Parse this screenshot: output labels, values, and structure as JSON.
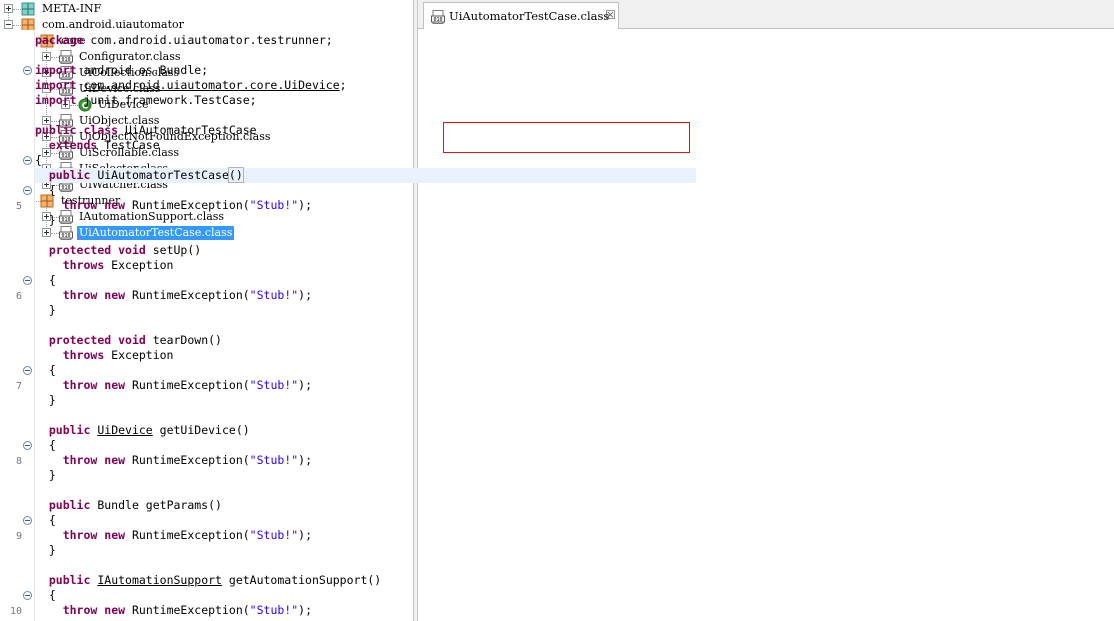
{
  "tree": {
    "nodes": [
      {
        "label": "META-INF",
        "icon": "folder-icon",
        "toggle": "plus"
      },
      {
        "label": "com.android.uiautomator",
        "icon": "package-icon",
        "toggle": "minus"
      },
      {
        "label": "core",
        "icon": "package-icon",
        "toggle": "minus"
      },
      {
        "label": "Configurator.class",
        "icon": "class-file-icon",
        "toggle": "plus"
      },
      {
        "label": "UiCollection.class",
        "icon": "class-file-icon",
        "toggle": "plus"
      },
      {
        "label": "UiDevice.class",
        "icon": "class-file-icon",
        "toggle": "minus"
      },
      {
        "label": "UiDevice",
        "icon": "class-icon",
        "toggle": "plus"
      },
      {
        "label": "UiObject.class",
        "icon": "class-file-icon",
        "toggle": "plus"
      },
      {
        "label": "UiObjectNotFoundException.class",
        "icon": "class-file-icon",
        "toggle": "plus"
      },
      {
        "label": "UiScrollable.class",
        "icon": "class-file-icon",
        "toggle": "plus"
      },
      {
        "label": "UiSelector.class",
        "icon": "class-file-icon",
        "toggle": "plus"
      },
      {
        "label": "UiWatcher.class",
        "icon": "class-file-icon",
        "toggle": "plus"
      },
      {
        "label": "testrunner",
        "icon": "package-icon",
        "toggle": "minus"
      },
      {
        "label": "IAutomationSupport.class",
        "icon": "class-file-icon",
        "toggle": "plus"
      },
      {
        "label": "UiAutomatorTestCase.class",
        "icon": "class-file-icon",
        "toggle": "plus",
        "selected": true
      }
    ]
  },
  "editor": {
    "tab_label": "UiAutomatorTestCase.class",
    "tab_close": "☒",
    "line_numbers": [
      "5",
      "6",
      "7",
      "8",
      "9",
      "10"
    ],
    "code_lines": [
      [
        {
          "t": "package",
          "k": "kw"
        },
        {
          "t": " com.android.uiautomator.testrunner;"
        }
      ],
      [],
      [
        {
          "t": "import",
          "k": "kw"
        },
        {
          "t": " android.os.Bundle;"
        }
      ],
      [
        {
          "t": "import",
          "k": "kw"
        },
        {
          "t": " "
        },
        {
          "t": "com.android.uiautomator.core.UiDevice",
          "k": "ul"
        },
        {
          "t": ";"
        }
      ],
      [
        {
          "t": "import",
          "k": "kw"
        },
        {
          "t": " junit.framework.TestCase;"
        }
      ],
      [],
      [
        {
          "t": "public",
          "k": "kw"
        },
        {
          "t": " "
        },
        {
          "t": "class",
          "k": "kw"
        },
        {
          "t": " UiAutomatorTestCase"
        }
      ],
      [
        {
          "t": "  "
        },
        {
          "t": "extends",
          "k": "kw"
        },
        {
          "t": " TestCase"
        }
      ],
      [
        {
          "t": "{"
        }
      ],
      [
        {
          "t": "  "
        },
        {
          "t": "public",
          "k": "kw"
        },
        {
          "t": " UiAutomatorTestCase"
        },
        {
          "t": "()",
          "k": "caret-paren"
        }
      ],
      [
        {
          "t": "  {"
        }
      ],
      [
        {
          "t": "    "
        },
        {
          "t": "throw",
          "k": "kw"
        },
        {
          "t": " "
        },
        {
          "t": "new",
          "k": "kw"
        },
        {
          "t": " RuntimeException("
        },
        {
          "t": "\"Stub!\"",
          "k": "str"
        },
        {
          "t": ");"
        }
      ],
      [
        {
          "t": "  }"
        }
      ],
      [],
      [
        {
          "t": "  "
        },
        {
          "t": "protected",
          "k": "kw"
        },
        {
          "t": " "
        },
        {
          "t": "void",
          "k": "kw"
        },
        {
          "t": " setUp()"
        }
      ],
      [
        {
          "t": "    "
        },
        {
          "t": "throws",
          "k": "kw"
        },
        {
          "t": " Exception"
        }
      ],
      [
        {
          "t": "  {"
        }
      ],
      [
        {
          "t": "    "
        },
        {
          "t": "throw",
          "k": "kw"
        },
        {
          "t": " "
        },
        {
          "t": "new",
          "k": "kw"
        },
        {
          "t": " RuntimeException("
        },
        {
          "t": "\"Stub!\"",
          "k": "str"
        },
        {
          "t": ");"
        }
      ],
      [
        {
          "t": "  }"
        }
      ],
      [],
      [
        {
          "t": "  "
        },
        {
          "t": "protected",
          "k": "kw"
        },
        {
          "t": " "
        },
        {
          "t": "void",
          "k": "kw"
        },
        {
          "t": " tearDown()"
        }
      ],
      [
        {
          "t": "    "
        },
        {
          "t": "throws",
          "k": "kw"
        },
        {
          "t": " Exception"
        }
      ],
      [
        {
          "t": "  {"
        }
      ],
      [
        {
          "t": "    "
        },
        {
          "t": "throw",
          "k": "kw"
        },
        {
          "t": " "
        },
        {
          "t": "new",
          "k": "kw"
        },
        {
          "t": " RuntimeException("
        },
        {
          "t": "\"Stub!\"",
          "k": "str"
        },
        {
          "t": ");"
        }
      ],
      [
        {
          "t": "  }"
        }
      ],
      [],
      [
        {
          "t": "  "
        },
        {
          "t": "public",
          "k": "kw"
        },
        {
          "t": " "
        },
        {
          "t": "UiDevice",
          "k": "ul"
        },
        {
          "t": " getUiDevice()"
        }
      ],
      [
        {
          "t": "  {"
        }
      ],
      [
        {
          "t": "    "
        },
        {
          "t": "throw",
          "k": "kw"
        },
        {
          "t": " "
        },
        {
          "t": "new",
          "k": "kw"
        },
        {
          "t": " RuntimeException("
        },
        {
          "t": "\"Stub!\"",
          "k": "str"
        },
        {
          "t": ");"
        }
      ],
      [
        {
          "t": "  }"
        }
      ],
      [],
      [
        {
          "t": "  "
        },
        {
          "t": "public",
          "k": "kw"
        },
        {
          "t": " Bundle getParams()"
        }
      ],
      [
        {
          "t": "  {"
        }
      ],
      [
        {
          "t": "    "
        },
        {
          "t": "throw",
          "k": "kw"
        },
        {
          "t": " "
        },
        {
          "t": "new",
          "k": "kw"
        },
        {
          "t": " RuntimeException("
        },
        {
          "t": "\"Stub!\"",
          "k": "str"
        },
        {
          "t": ");"
        }
      ],
      [
        {
          "t": "  }"
        }
      ],
      [],
      [
        {
          "t": "  "
        },
        {
          "t": "public",
          "k": "kw"
        },
        {
          "t": " "
        },
        {
          "t": "IAutomationSupport",
          "k": "ul"
        },
        {
          "t": " getAutomationSupport()"
        }
      ],
      [
        {
          "t": "  {"
        }
      ],
      [
        {
          "t": "    "
        },
        {
          "t": "throw",
          "k": "kw"
        },
        {
          "t": " "
        },
        {
          "t": "new",
          "k": "kw"
        },
        {
          "t": " RuntimeException("
        },
        {
          "t": "\"Stub!\"",
          "k": "str"
        },
        {
          "t": ");"
        }
      ]
    ]
  },
  "colors": {
    "keyword": "#7f0055",
    "string": "#2a00ff",
    "selection": "#3399ff",
    "highlight_box": "#e81010",
    "current_line": "#e8f2fe"
  }
}
